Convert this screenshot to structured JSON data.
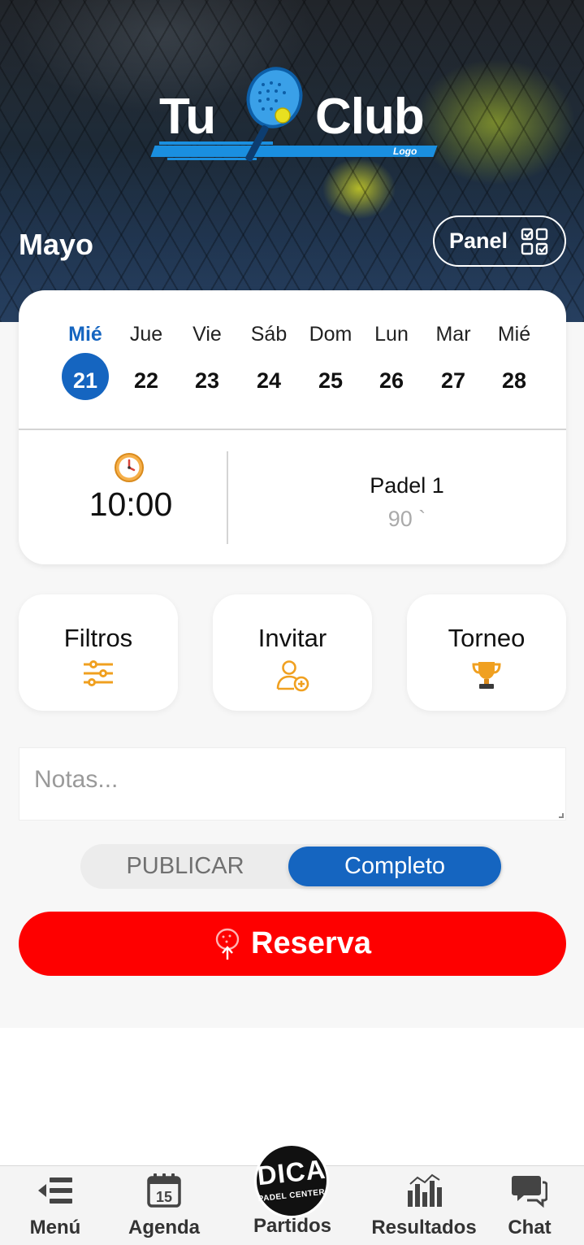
{
  "header": {
    "logo_tu": "Tu",
    "logo_club": "Club",
    "logo_sub": "Logo",
    "month": "Mayo",
    "panel_label": "Panel"
  },
  "calendar": {
    "days": [
      {
        "name": "Mié",
        "date": "21",
        "active": true
      },
      {
        "name": "Jue",
        "date": "22"
      },
      {
        "name": "Vie",
        "date": "23"
      },
      {
        "name": "Sáb",
        "date": "24"
      },
      {
        "name": "Dom",
        "date": "25"
      },
      {
        "name": "Lun",
        "date": "26"
      },
      {
        "name": "Mar",
        "date": "27"
      },
      {
        "name": "Mié",
        "date": "28"
      }
    ]
  },
  "booking": {
    "time": "10:00",
    "court": "Padel 1",
    "duration": "90 `"
  },
  "options": {
    "filters": "Filtros",
    "invite": "Invitar",
    "tournament": "Torneo"
  },
  "notes": {
    "placeholder": "Notas..."
  },
  "toggle": {
    "off_label": "PUBLICAR",
    "on_label": "Completo"
  },
  "reserve_label": "Reserva",
  "nav": {
    "menu": "Menú",
    "agenda": "Agenda",
    "agenda_day": "15",
    "matches": "Partidos",
    "results": "Resultados",
    "chat": "Chat",
    "brand_top": "DICA",
    "brand_bottom": "PADEL CENTER"
  },
  "colors": {
    "accent_blue": "#1565c0",
    "reserve_red": "#fe0000",
    "icon_gold": "#f0a020"
  }
}
